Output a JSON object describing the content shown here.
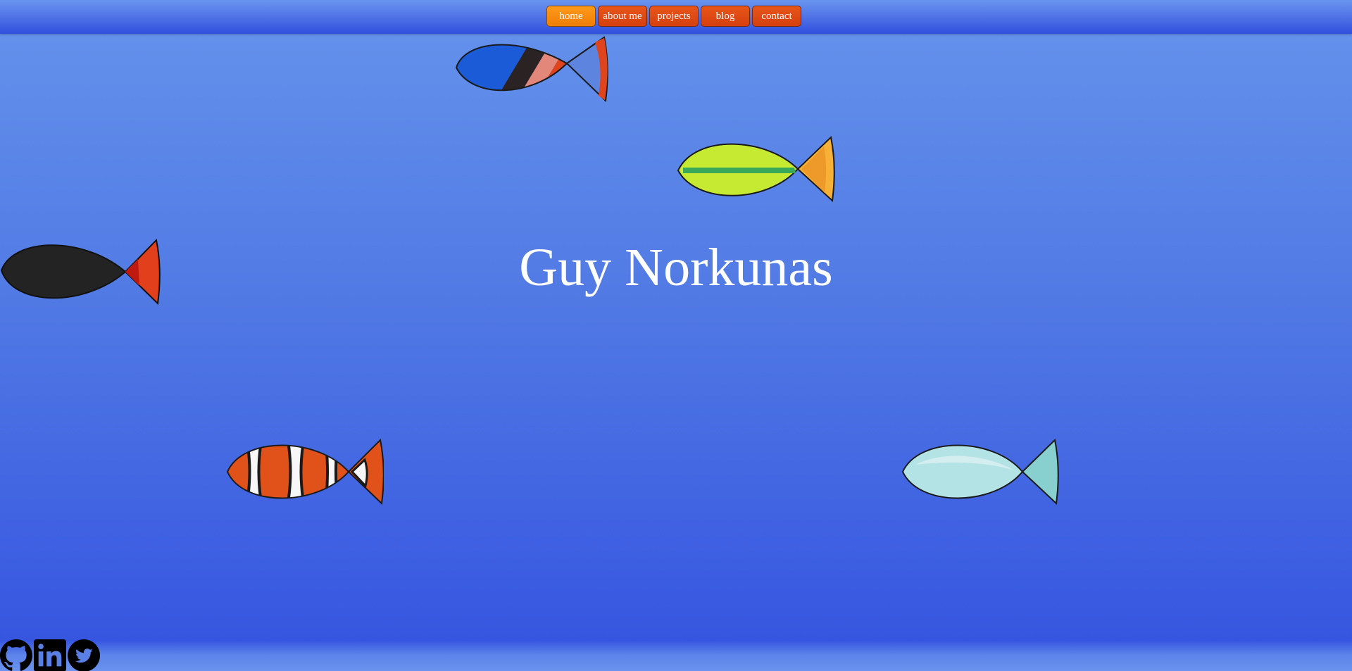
{
  "nav": {
    "items": [
      {
        "label": "home"
      },
      {
        "label": "about me"
      },
      {
        "label": "projects"
      },
      {
        "label": "blog"
      },
      {
        "label": "contact"
      }
    ],
    "active_index": 0
  },
  "hero": {
    "title": "Guy Norkunas"
  },
  "social": {
    "icons": [
      "github-icon",
      "linkedin-icon",
      "twitter-icon"
    ]
  },
  "colors": {
    "background_top": "#6593ec",
    "background_bottom": "#3453e0",
    "nav_button": "#d8420e",
    "nav_button_active": "#f5850a",
    "title_text": "#ffffff"
  },
  "fish": [
    {
      "name": "blue-tang-fish"
    },
    {
      "name": "yellow-green-fish"
    },
    {
      "name": "black-red-fish"
    },
    {
      "name": "clownfish"
    },
    {
      "name": "pale-blue-fish"
    }
  ]
}
